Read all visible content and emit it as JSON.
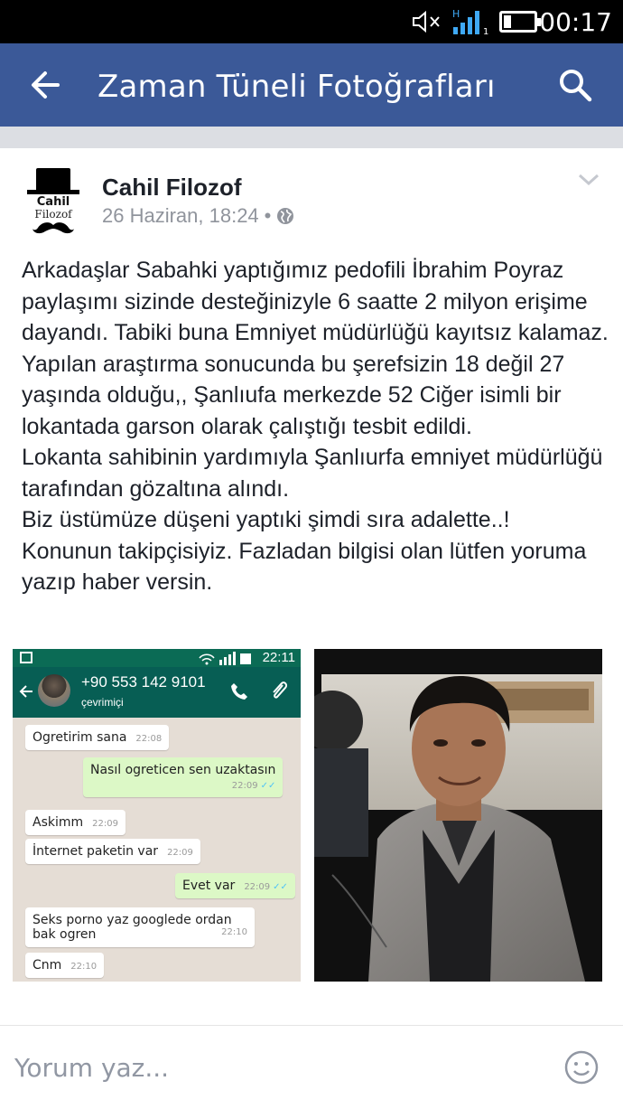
{
  "status_bar": {
    "time": "00:17",
    "icons": [
      "mute-icon",
      "signal-icon",
      "battery-icon"
    ]
  },
  "app_bar": {
    "title": "Zaman Tüneli Fotoğrafları",
    "color": "#3b5998"
  },
  "post": {
    "author": "Cahil Filozof",
    "avatar_text": [
      "Cahil",
      "Filozof"
    ],
    "timestamp": "26 Haziran, 18:24",
    "separator": "•",
    "paragraphs": [
      "Arkadaşlar Sabahki yaptığımız pedofili İbrahim Poyraz paylaşımı sizinde desteğinizyle 6 saatte 2 milyon erişime dayandı. Tabiki buna Emniyet müdürlüğü kayıtsız kalamaz.",
      "Yapılan araştırma sonucunda bu şerefsizin 18 değil 27 yaşında olduğu,, Şanlıufa merkezde 52 Ciğer isimli bir lokantada garson olarak çalıştığı tesbit edildi.",
      "Lokanta sahibinin yardımıyla Şanlıurfa emniyet müdürlüğü tarafından gözaltına alındı.",
      "Biz üstümüze düşeni yaptıki şimdi sıra adalette..!",
      "Konunun takipçisiyiz. Fazladan bilgisi olan lütfen yoruma yazıp haber versin."
    ]
  },
  "chat_screenshot": {
    "status_time": "22:11",
    "contact": "+90 553 142 9101",
    "contact_status": "çevrimiçi",
    "messages": [
      {
        "text": "Ogretirim sana",
        "time": "22:08",
        "dir": "in"
      },
      {
        "text": "Nasıl ogreticen sen uzaktasın",
        "time": "22:09",
        "dir": "out",
        "ticks": "✓✓"
      },
      {
        "text": "Askimm",
        "time": "22:09",
        "dir": "in"
      },
      {
        "text": "İnternet paketin var",
        "time": "22:09",
        "dir": "in"
      },
      {
        "text": "Evet var",
        "time": "22:09",
        "dir": "out",
        "ticks": "✓✓"
      },
      {
        "text": "Seks porno yaz googlede ordan",
        "text2": "bak ogren",
        "time": "22:10",
        "dir": "in"
      },
      {
        "text": "Cnm",
        "time": "22:10",
        "dir": "in"
      }
    ]
  },
  "composer": {
    "placeholder": "Yorum yaz..."
  }
}
